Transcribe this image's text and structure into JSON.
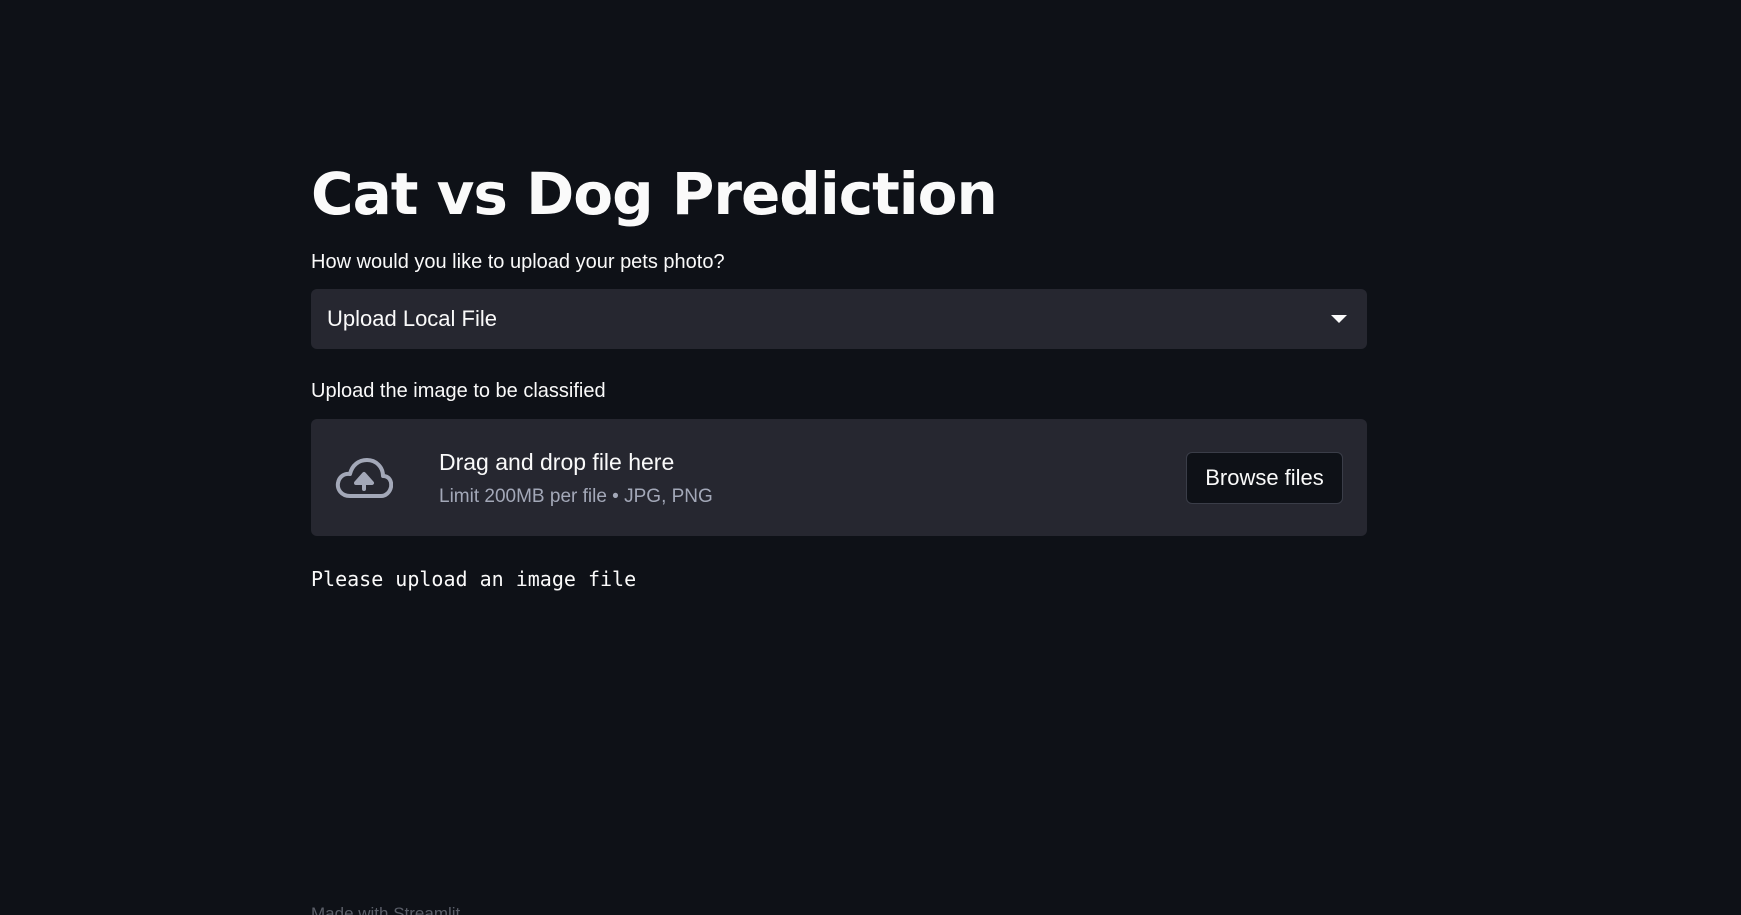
{
  "page": {
    "title": "Cat vs Dog Prediction"
  },
  "upload_method": {
    "label": "How would you like to upload your pets photo?",
    "selected_option": "Upload Local File",
    "dropdown_icon": "chevron-down-icon"
  },
  "file_uploader": {
    "label": "Upload the image to be classified",
    "dropzone_title": "Drag and drop file here",
    "dropzone_subtitle": "Limit 200MB per file • JPG, PNG",
    "upload_icon": "cloud-upload-icon",
    "browse_button_label": "Browse files"
  },
  "status": {
    "message": "Please upload an image file"
  },
  "footer": {
    "text": "Made with Streamlit"
  },
  "colors": {
    "background": "#0e1117",
    "widget_background": "#262730",
    "text_primary": "#fafafa",
    "text_muted": "#a3a8b8"
  }
}
